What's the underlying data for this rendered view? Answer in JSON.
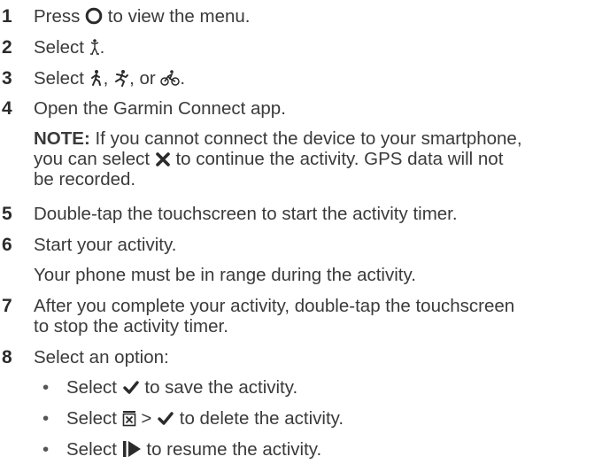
{
  "cut_top_text": "                                                                                                ",
  "steps": [
    {
      "num": "1",
      "before": "Press ",
      "after": " to view the menu."
    },
    {
      "num": "2",
      "before": "Select ",
      "after": "."
    },
    {
      "num": "3",
      "before": "Select ",
      "mid1": ", ",
      "mid2": ", or ",
      "after": "."
    },
    {
      "num": "4",
      "text": "Open the Garmin Connect app."
    },
    {
      "num": "5",
      "text": "Double-tap the touchscreen to start the activity timer."
    },
    {
      "num": "6",
      "text": "Start your activity."
    },
    {
      "num": "7",
      "line1": "After you complete your activity, double-tap the touchscreen",
      "line2": "to stop the activity timer."
    },
    {
      "num": "8",
      "text": "Select an option:"
    }
  ],
  "note": {
    "label": "NOTE:",
    "line1": " If you cannot connect the device to your smartphone,",
    "line2_before": "you can select ",
    "line2_after": " to continue the activity. GPS data will not",
    "line3": "be recorded."
  },
  "step6_detail": "Your phone must be in range during the activity.",
  "options": [
    {
      "before": "Select ",
      "after": " to save the activity."
    },
    {
      "before": "Select ",
      "mid": " > ",
      "after": " to delete the activity."
    },
    {
      "before": "Select ",
      "after": " to resume the activity."
    }
  ],
  "bullet_char": "•",
  "icons": {
    "circle": "circle-button-icon",
    "activity": "activity-icon",
    "walk": "walk-icon",
    "run": "run-icon",
    "bike": "bike-icon",
    "cross": "cross-icon",
    "check": "check-icon",
    "discard": "discard-icon",
    "resume": "resume-icon"
  }
}
